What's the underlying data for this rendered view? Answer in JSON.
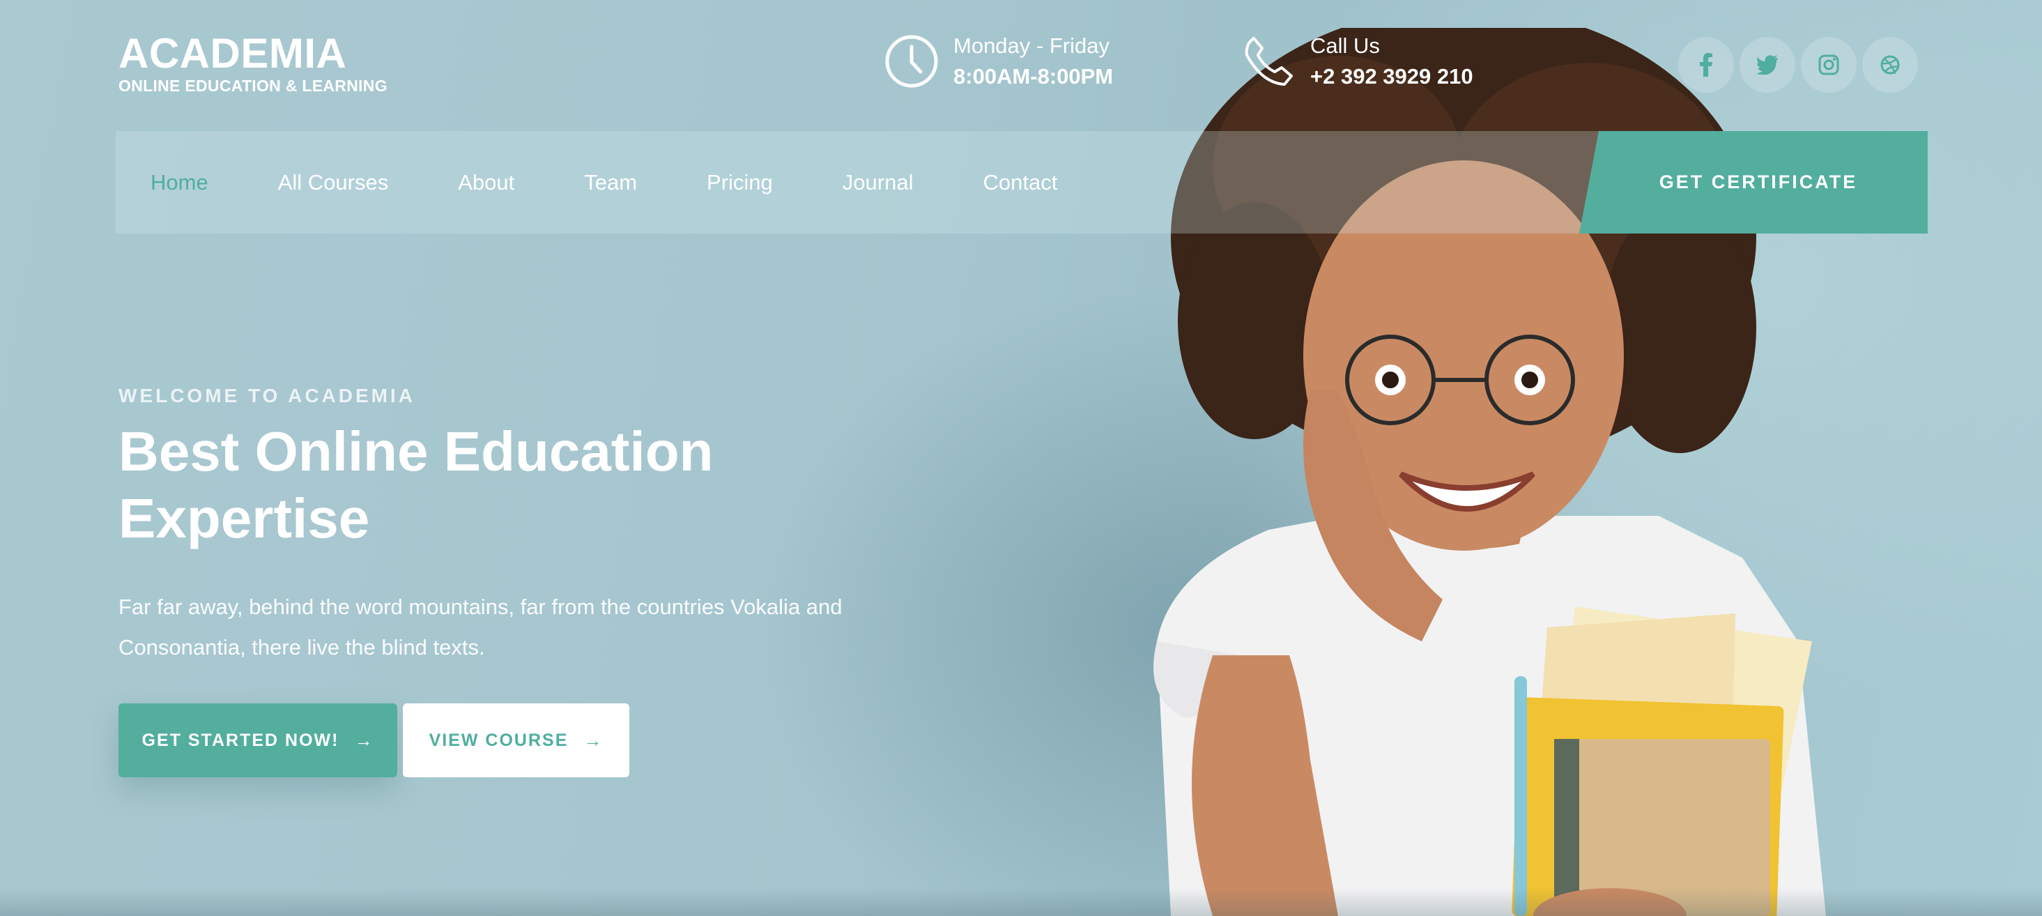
{
  "brand": {
    "name": "ACADEMIA",
    "tagline": "ONLINE EDUCATION & LEARNING"
  },
  "hours": {
    "icon": "clock-icon",
    "line1": "Monday - Friday",
    "line2": "8:00AM-8:00PM"
  },
  "call": {
    "icon": "phone-icon",
    "line1": "Call Us",
    "line2": "+2 392 3929 210"
  },
  "socials": [
    {
      "icon": "facebook-icon",
      "glyph": "f"
    },
    {
      "icon": "twitter-icon",
      "glyph": "t"
    },
    {
      "icon": "instagram-icon",
      "glyph": "ig"
    },
    {
      "icon": "dribbble-icon",
      "glyph": "db"
    }
  ],
  "nav": {
    "items": [
      "Home",
      "All Courses",
      "About",
      "Team",
      "Pricing",
      "Journal",
      "Contact"
    ],
    "active": "Home",
    "cta": "GET CERTIFICATE"
  },
  "hero": {
    "eyebrow": "WELCOME TO ACADEMIA",
    "headline": "Best Online Education Expertise",
    "lead": "Far far away, behind the word mountains, far from the countries Vokalia and Consonantia, there live the blind texts.",
    "primary_button": "GET STARTED NOW!",
    "secondary_button": "VIEW COURSE"
  },
  "colors": {
    "accent": "#53ae9e",
    "background": "#a9c8d0",
    "text": "#ffffff"
  }
}
